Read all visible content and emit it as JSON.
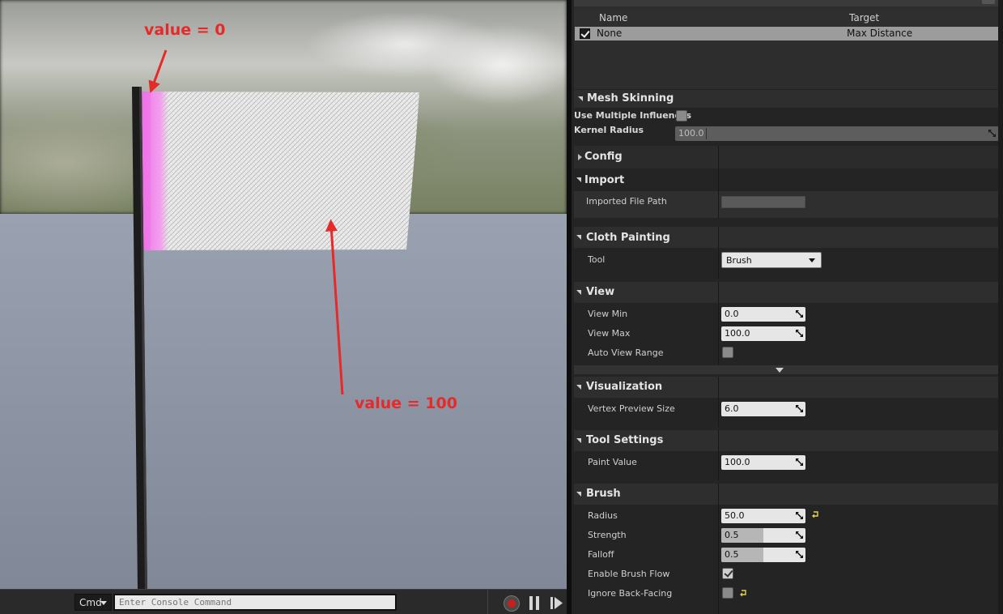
{
  "viewport": {
    "annotations": {
      "top": "value = 0",
      "bottom": "value = 100"
    }
  },
  "console": {
    "dropdown_label": "Cmd",
    "input_placeholder": "Enter Console Command"
  },
  "masks_table": {
    "columns": [
      "Name",
      "Target"
    ],
    "rows": [
      {
        "checked": true,
        "name": "None",
        "target": "Max Distance"
      }
    ]
  },
  "mesh_skinning": {
    "title": "Mesh Skinning",
    "use_multiple_influences_label": "Use Multiple Influences",
    "use_multiple_influences": false,
    "kernel_radius_label": "Kernel Radius",
    "kernel_radius": "100.0"
  },
  "config": {
    "title": "Config"
  },
  "import": {
    "title": "Import",
    "imported_file_path_label": "Imported File Path",
    "imported_file_path": ""
  },
  "cloth_painting": {
    "title": "Cloth Painting",
    "tool_label": "Tool",
    "tool_value": "Brush"
  },
  "view": {
    "title": "View",
    "view_min_label": "View Min",
    "view_min": "0.0",
    "view_max_label": "View Max",
    "view_max": "100.0",
    "auto_view_range_label": "Auto View Range",
    "auto_view_range": false
  },
  "visualization": {
    "title": "Visualization",
    "vertex_preview_size_label": "Vertex Preview Size",
    "vertex_preview_size": "6.0"
  },
  "tool_settings": {
    "title": "Tool Settings",
    "paint_value_label": "Paint Value",
    "paint_value": "100.0"
  },
  "brush": {
    "title": "Brush",
    "radius_label": "Radius",
    "radius": "50.0",
    "strength_label": "Strength",
    "strength": "0.5",
    "strength_fraction": 0.5,
    "falloff_label": "Falloff",
    "falloff": "0.5",
    "falloff_fraction": 0.5,
    "enable_brush_flow_label": "Enable Brush Flow",
    "enable_brush_flow": true,
    "ignore_back_facing_label": "Ignore Back-Facing",
    "ignore_back_facing": false
  },
  "colors": {
    "accent_reset": "#e8d24a",
    "paint_zero": "#f06fe8",
    "annotation": "#e52a2a"
  },
  "icons": [
    "record-icon",
    "pause-icon",
    "step-icon",
    "reset-to-default-icon",
    "spin-arrows-icon",
    "checkmark-icon"
  ]
}
